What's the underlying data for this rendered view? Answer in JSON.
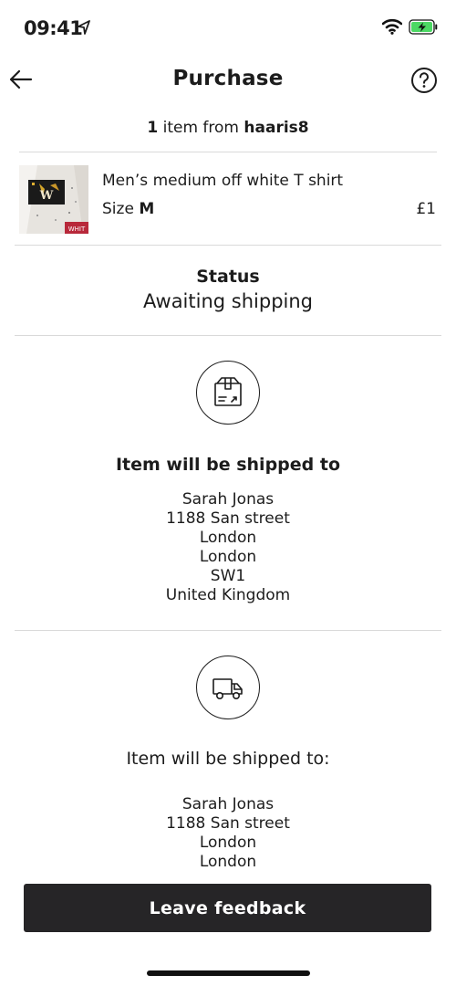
{
  "status_bar": {
    "time": "09:41",
    "icons": [
      "location-arrow-icon",
      "wifi-icon",
      "battery-charging-icon"
    ],
    "battery_color": "#4cd964"
  },
  "nav": {
    "title": "Purchase",
    "back_icon": "arrow-left-icon",
    "help_icon": "question-circle-icon"
  },
  "seller": {
    "count": "1",
    "middle": " item from ",
    "username": "haaris8"
  },
  "item": {
    "name": "Men’s medium off white T shirt",
    "size_label": "Size ",
    "size_value": "M",
    "price": "£1"
  },
  "status": {
    "label": "Status",
    "value": "Awaiting shipping"
  },
  "shipping": {
    "icon": "package-icon",
    "heading": "Item will be shipped to",
    "address": [
      "Sarah Jonas",
      "1188 San street",
      "London",
      "London",
      "SW1",
      "United Kingdom"
    ]
  },
  "shipping_2": {
    "icon": "delivery-truck-icon",
    "heading": "Item will be shipped to:",
    "address": [
      "Sarah Jonas",
      "1188 San street",
      "London",
      "London"
    ]
  },
  "actions": {
    "feedback_label": "Leave feedback"
  },
  "colors": {
    "button_bg": "#262527",
    "divider": "#d9d9d9",
    "text": "#1c1c1c"
  }
}
